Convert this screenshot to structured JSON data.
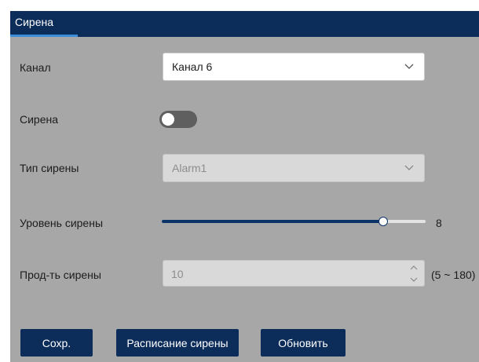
{
  "tab": {
    "label": "Сирена"
  },
  "channel": {
    "label": "Канал",
    "value": "Канал 6"
  },
  "siren": {
    "label": "Сирена",
    "enabled": false
  },
  "siren_type": {
    "label": "Тип сирены",
    "value": "Alarm1"
  },
  "siren_level": {
    "label": "Уровень сирены",
    "value": "8",
    "fraction": 0.84
  },
  "siren_duration": {
    "label": "Прод-ть сирены",
    "value": "10",
    "range_hint": "(5 ~ 180)"
  },
  "buttons": {
    "save": "Сохр.",
    "schedule": "Расписание сирены",
    "refresh": "Обновить"
  },
  "colors": {
    "header": "#0c2c5a",
    "panel_bg": "#a7a7a7",
    "accent": "#3b8fd8"
  }
}
